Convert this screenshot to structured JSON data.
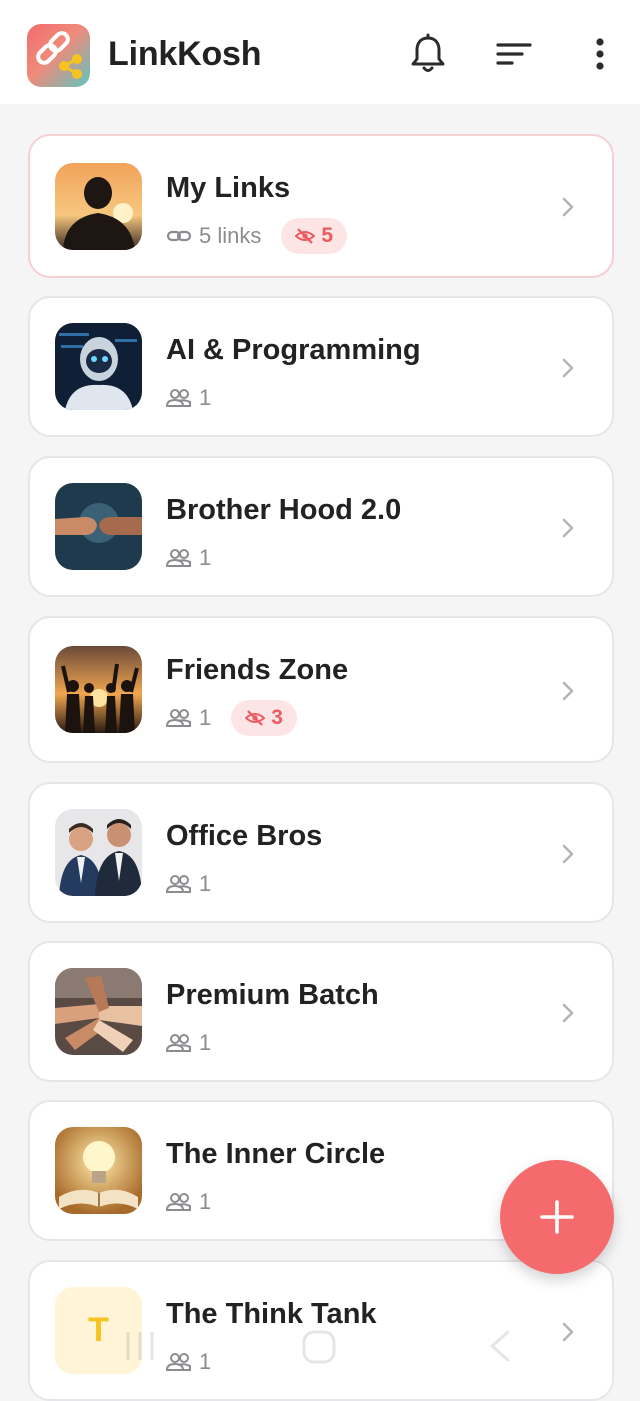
{
  "app": {
    "title": "LinkKosh",
    "accent_color": "#f56a6c",
    "logo_icon": "link-share-icon"
  },
  "toolbar": {
    "icons": [
      "bell-icon",
      "sort-icon",
      "more-vert-icon"
    ]
  },
  "groups": [
    {
      "name": "My Links",
      "meta_icon": "link-icon",
      "meta_text": "5 links",
      "hidden_count": "5",
      "thumbnail": "silhouette-sunset",
      "selected": true
    },
    {
      "name": "AI & Programming",
      "meta_icon": "members-icon",
      "meta_text": "1",
      "hidden_count": null,
      "thumbnail": "robot"
    },
    {
      "name": "Brother Hood 2.0",
      "meta_icon": "members-icon",
      "meta_text": "1",
      "hidden_count": null,
      "thumbnail": "fist-bump"
    },
    {
      "name": "Friends Zone",
      "meta_icon": "members-icon",
      "meta_text": "1",
      "hidden_count": "3",
      "thumbnail": "friends-sunset"
    },
    {
      "name": "Office Bros",
      "meta_icon": "members-icon",
      "meta_text": "1",
      "hidden_count": null,
      "thumbnail": "two-men-suits"
    },
    {
      "name": "Premium Batch",
      "meta_icon": "members-icon",
      "meta_text": "1",
      "hidden_count": null,
      "thumbnail": "stacked-hands"
    },
    {
      "name": "The Inner Circle",
      "meta_icon": "members-icon",
      "meta_text": "1",
      "hidden_count": null,
      "thumbnail": "lightbulb-book"
    },
    {
      "name": "The Think Tank",
      "meta_icon": "members-icon",
      "meta_text": "1",
      "hidden_count": null,
      "thumbnail": "letter-avatar",
      "avatar_letter": "T"
    }
  ],
  "fab": {
    "icon": "plus-icon"
  }
}
